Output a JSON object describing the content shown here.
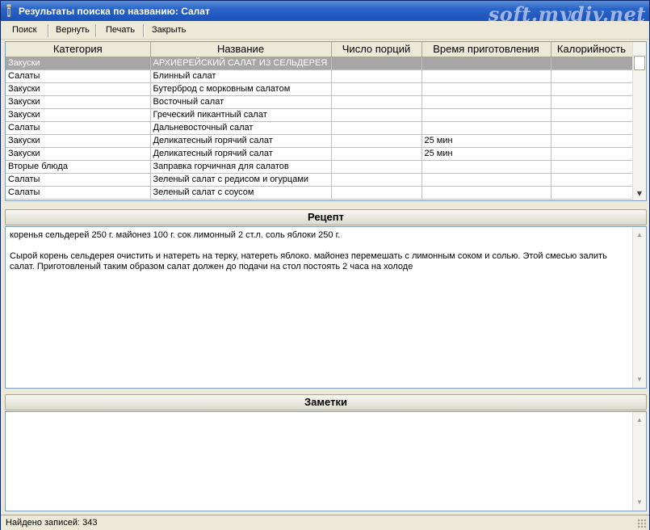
{
  "window": {
    "title": "Результаты поиска по названию: Салат",
    "watermark": "soft.mydiv.net"
  },
  "menu": {
    "items": [
      {
        "label": "Поиск"
      },
      {
        "label": "Вернуть"
      },
      {
        "label": "Печать"
      },
      {
        "label": "Закрыть"
      }
    ]
  },
  "grid": {
    "columns": [
      "Категория",
      "Название",
      "Число порций",
      "Время приготовления",
      "Калорийность"
    ],
    "rows": [
      {
        "category": "Закуски",
        "name": "АРХИЕРЕЙСКИЙ САЛАТ ИЗ СЕЛЬДЕРЕЯ",
        "portions": "",
        "time": "",
        "calories": "",
        "selected": true
      },
      {
        "category": "Салаты",
        "name": "Блинный салат",
        "portions": "",
        "time": "",
        "calories": ""
      },
      {
        "category": "Закуски",
        "name": "Бутерброд с морковным салатом",
        "portions": "",
        "time": "",
        "calories": ""
      },
      {
        "category": "Закуски",
        "name": "Восточный салат",
        "portions": "",
        "time": "",
        "calories": ""
      },
      {
        "category": "Закуски",
        "name": "Греческий пикантный салат",
        "portions": "",
        "time": "",
        "calories": ""
      },
      {
        "category": "Салаты",
        "name": "Дальневосточный салат",
        "portions": "",
        "time": "",
        "calories": ""
      },
      {
        "category": "Закуски",
        "name": "Деликатесный горячий салат",
        "portions": "",
        "time": "25 мин",
        "calories": ""
      },
      {
        "category": "Закуски",
        "name": "Деликатесный горячий салат",
        "portions": "",
        "time": "25 мин",
        "calories": ""
      },
      {
        "category": "Вторые блюда",
        "name": "Заправка горчичная для салатов",
        "portions": "",
        "time": "",
        "calories": ""
      },
      {
        "category": "Салаты",
        "name": "Зеленый салат с редисом и огурцами",
        "portions": "",
        "time": "",
        "calories": ""
      },
      {
        "category": "Салаты",
        "name": "Зеленый салат с соусом",
        "portions": "",
        "time": "",
        "calories": ""
      }
    ]
  },
  "recipe": {
    "header": "Рецепт",
    "ingredients": "коренья сельдерей 250 г. майонез 100 г. сок лимонный 2 ст.л. соль яблоки 250 г.",
    "instructions": "Сырой корень сельдерея очистить и натереть на терку, натереть  яблоко. майонез перемешать с лимонным соком и солью. Этой  смесью залить салат. Приготовленый таким образом салат должен  до подачи на стол постоять 2 часа на холоде"
  },
  "notes": {
    "header": "Заметки",
    "text": ""
  },
  "status": {
    "text": "Найдено записей: 343"
  },
  "colors": {
    "titlebar": "#2a63c8",
    "selected_row": "#a6a6a6",
    "window_bg": "#ece9d8"
  }
}
